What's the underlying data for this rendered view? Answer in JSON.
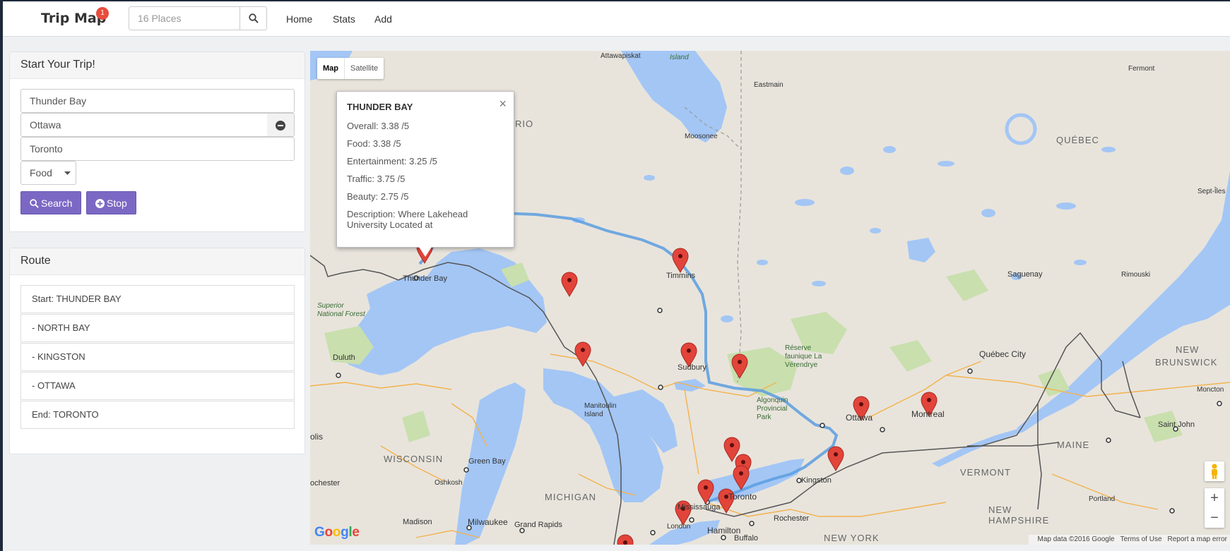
{
  "navbar": {
    "brand": "Trip Map",
    "badge": "1",
    "search_placeholder": "16 Places",
    "links": [
      "Home",
      "Stats",
      "Add"
    ]
  },
  "trip_panel": {
    "title": "Start Your Trip!",
    "start": "Thunder Bay",
    "via": "Ottawa",
    "end": "Toronto",
    "category": "Food",
    "search_label": "Search",
    "stop_label": "Stop"
  },
  "route_panel": {
    "title": "Route",
    "items": [
      "Start: THUNDER BAY",
      "- NORTH BAY",
      "- KINGSTON",
      "- OTTAWA",
      "End: TORONTO"
    ]
  },
  "map": {
    "type_map": "Map",
    "type_satellite": "Satellite",
    "info": {
      "title": "THUNDER BAY",
      "overall": "Overall: 3.38 /5",
      "food": "Food: 3.38 /5",
      "entertainment": "Entertainment: 3.25 /5",
      "traffic": "Traffic: 3.75 /5",
      "beauty": "Beauty: 2.75 /5",
      "description": "Description: Where Lakehead University Located at"
    },
    "attribution": [
      "Map data ©2016 Google",
      "Terms of Use",
      "Report a map error"
    ],
    "zoom_in": "+",
    "zoom_out": "−",
    "logo": [
      "G",
      "o",
      "o",
      "g",
      "l",
      "e"
    ],
    "labels": {
      "thunder_bay": "Thunder Bay",
      "superior": "Superior",
      "national_forest": "National Forest",
      "duluth": "Duluth",
      "timmins": "Timmins",
      "moosonee": "Moosonee",
      "attawapiskat": "Attawapiskat",
      "island": "Island",
      "eastmain": "Eastmain",
      "fermont": "Fermont",
      "quebec": "QUÉBEC",
      "sept_iles": "Sept-Îles",
      "saguenay": "Saguenay",
      "rimouski": "Rimouski",
      "quebec_city": "Québec City",
      "new": "NEW",
      "brunswick": "BRUNSWICK",
      "moncton": "Moncton",
      "saint_john": "Saint John",
      "maine": "MAINE",
      "vermont": "VERMONT",
      "new_hampshire": "NEW\nHAMPSHIRE",
      "portland": "Portland",
      "sudbury": "Sudbury",
      "reserve": "Réserve\nfaunique La\nVérendrye",
      "algonquin": "Algonquin\nProvincial\nPark",
      "ottawa": "Ottawa",
      "montreal": "Montreal",
      "kingston": "Kingston",
      "manitoulin": "Manitoulin\nIsland",
      "toronto": "Toronto",
      "mississauga": "Mississauga",
      "hamilton": "Hamilton",
      "london": "London",
      "buffalo": "Buffalo",
      "rochester": "Rochester",
      "new_york": "NEW YORK",
      "michigan": "MICHIGAN",
      "wisconsin": "WISCONSIN",
      "green_bay": "Green Bay",
      "oshkosh": "Oshkosh",
      "milwaukee": "Milwaukee",
      "madison": "Madison",
      "grand_rapids": "Grand Rapids",
      "rochester_mn": "ochester",
      "polis": "olis",
      "rio": "RIO"
    }
  },
  "colors": {
    "accent": "#7b68c4",
    "badge": "#e74c3c",
    "water": "#a3c6f5",
    "land": "#e8e4dc",
    "park": "#c9dfae",
    "route": "#5b9ee0",
    "marker": "#e2443a"
  }
}
